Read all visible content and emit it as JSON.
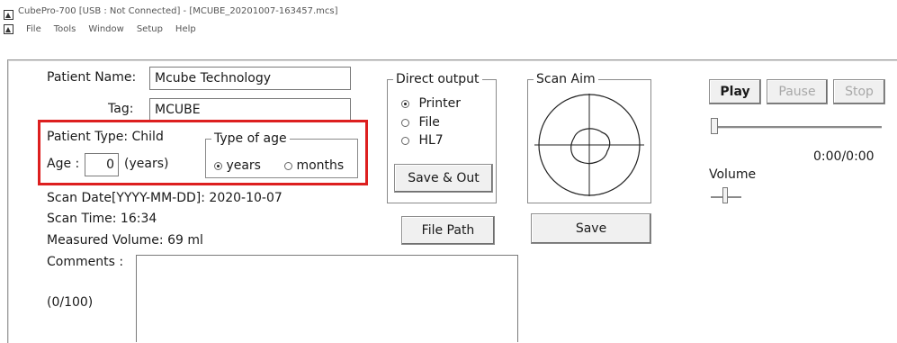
{
  "window": {
    "title": "CubePro-700 [USB : Not Connected] - [MCUBE_20201007-163457.mcs]"
  },
  "menu": [
    "File",
    "Tools",
    "Window",
    "Setup",
    "Help"
  ],
  "patient": {
    "name_label": "Patient Name:",
    "name_value": "Mcube Technology",
    "tag_label": "Tag:",
    "tag_value": "MCUBE",
    "type_text": "Patient Type: Child",
    "age_label": "Age :",
    "age_value": "0",
    "age_unit": "(years)",
    "age_type_group": "Type of age",
    "age_type_options": [
      "years",
      "months"
    ],
    "age_type_selected": "years",
    "scan_date": "Scan Date[YYYY-MM-DD]: 2020-10-07",
    "scan_time": "Scan Time: 16:34",
    "measured_volume": "Measured Volume: 69 ml",
    "comments_label": "Comments :",
    "comments_count": "(0/100)",
    "comments_value": ""
  },
  "direct_output": {
    "title": "Direct output",
    "options": [
      "Printer",
      "File",
      "HL7"
    ],
    "selected": "Printer",
    "save_out_label": "Save & Out",
    "file_path_label": "File Path"
  },
  "scan_aim": {
    "title": "Scan Aim",
    "save_label": "Save"
  },
  "player": {
    "play_label": "Play",
    "pause_label": "Pause",
    "stop_label": "Stop",
    "time": "0:00/0:00",
    "position_fraction": 0.0,
    "volume_label": "Volume",
    "volume_fraction": 0.45
  },
  "colors": {
    "highlight_border": "#dd1f1f"
  }
}
